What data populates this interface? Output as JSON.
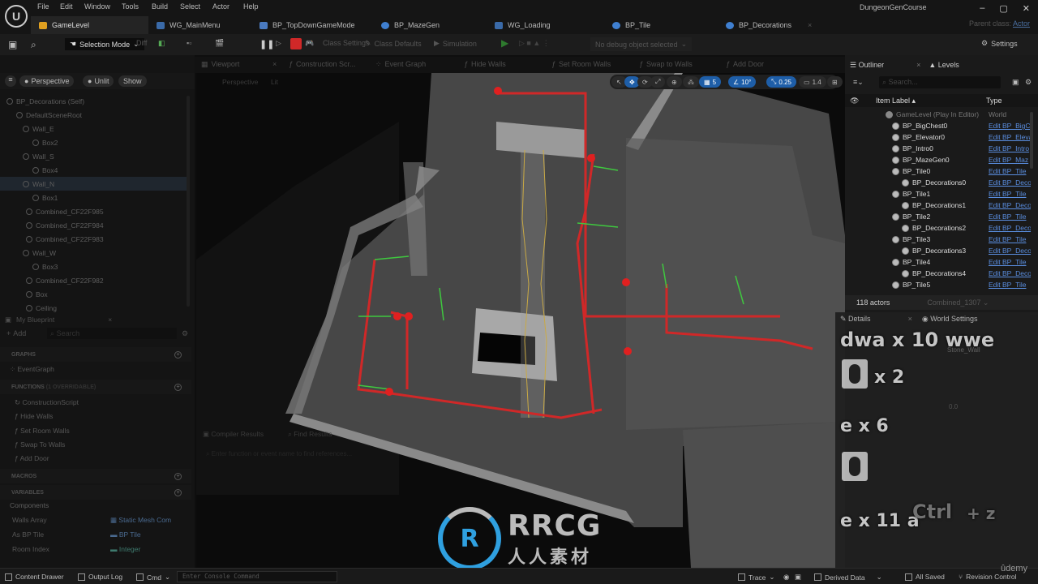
{
  "menu": [
    "File",
    "Edit",
    "Window",
    "Tools",
    "Build",
    "Select",
    "Actor",
    "Help"
  ],
  "project_name": "DungeonGenCourse",
  "parent_class": {
    "label": "Parent class:",
    "value": "Actor"
  },
  "doc_tabs": [
    {
      "label": "GameLevel",
      "icon": "level-icon",
      "active": true
    },
    {
      "label": "WG_MainMenu",
      "icon": "widget-icon"
    },
    {
      "label": "BP_TopDownGameMode",
      "icon": "gamemode-icon"
    },
    {
      "label": "BP_MazeGen",
      "icon": "blueprint-icon"
    },
    {
      "label": "WG_Loading",
      "icon": "widget-icon"
    },
    {
      "label": "BP_Tile",
      "icon": "blueprint-icon"
    },
    {
      "label": "BP_Decorations",
      "icon": "blueprint-icon"
    }
  ],
  "toolbar": {
    "selection_mode": "Selection Mode",
    "diff": "Diff",
    "class_settings": "Class Settings",
    "class_defaults": "Class Defaults",
    "simulation": "Simulation",
    "debug_object": "No debug object selected",
    "settings": "Settings"
  },
  "editor_tabs": [
    {
      "label": "Viewport 1"
    },
    {
      "label": "Viewport"
    },
    {
      "label": "Construction Scr..."
    },
    {
      "label": "Event Graph"
    },
    {
      "label": "Hide Walls"
    },
    {
      "label": "Set Room Walls"
    },
    {
      "label": "Swap to Walls"
    },
    {
      "label": "Add Door"
    }
  ],
  "viewport_toolbar": {
    "perspective": "Perspective",
    "unlit": "Unlit",
    "show": "Show",
    "bp_perspective": "Perspective",
    "bp_lit": "Lit",
    "grid_snap": "5",
    "rotation_snap": "10°",
    "scale_snap": "0.25",
    "camera_speed": "1.4"
  },
  "components": {
    "root": "BP_Decorations (Self)",
    "items": [
      {
        "label": "DefaultSceneRoot",
        "depth": 1
      },
      {
        "label": "Wall_E",
        "depth": 2
      },
      {
        "label": "Box2",
        "depth": 3
      },
      {
        "label": "Wall_S",
        "depth": 2
      },
      {
        "label": "Box4",
        "depth": 3
      },
      {
        "label": "Wall_N",
        "depth": 2,
        "selected": true
      },
      {
        "label": "Box1",
        "depth": 3
      },
      {
        "label": "Combined_CF22F985",
        "depth": 2
      },
      {
        "label": "Combined_CF22F984",
        "depth": 2
      },
      {
        "label": "Combined_CF22F983",
        "depth": 2
      },
      {
        "label": "Wall_W",
        "depth": 2
      },
      {
        "label": "Box3",
        "depth": 3
      },
      {
        "label": "Combined_CF22F982",
        "depth": 2
      },
      {
        "label": "Box",
        "depth": 2
      },
      {
        "label": "Ceiling",
        "depth": 2
      }
    ]
  },
  "my_blueprint": {
    "title": "My Blueprint",
    "add": "Add",
    "search_placeholder": "Search",
    "graphs_label": "GRAPHS",
    "event_graph": "EventGraph",
    "functions_label": "FUNCTIONS",
    "functions_overridable": "(1 OVERRIDABLE)",
    "functions": [
      "ConstructionScript",
      "Hide Walls",
      "Set Room Walls",
      "Swap To Walls",
      "Add Door"
    ],
    "macros_label": "MACROS",
    "variables_label": "VARIABLES",
    "components_label": "Components",
    "variables": [
      {
        "name": "Walls Array",
        "type": "Static Mesh Com"
      },
      {
        "name": "As BP Tile",
        "type": "BP Tile"
      },
      {
        "name": "Room Index",
        "type": "Integer"
      }
    ]
  },
  "bottom_tabs": {
    "compiler": "Compiler Results",
    "find": "Find Results",
    "find_placeholder": "Enter function or event name to find references..."
  },
  "outliner": {
    "title": "Outliner",
    "levels": "Levels",
    "search_placeholder": "Search...",
    "col_label": "Item Label",
    "col_type": "Type",
    "rows": [
      {
        "label": "GameLevel (Play In Editor)",
        "type": "World",
        "depth": 0
      },
      {
        "label": "BP_BigChest0",
        "type": "Edit BP_BigC",
        "depth": 1
      },
      {
        "label": "BP_Elevator0",
        "type": "Edit BP_Eleva",
        "depth": 1
      },
      {
        "label": "BP_Intro0",
        "type": "Edit BP_Intro",
        "depth": 1
      },
      {
        "label": "BP_MazeGen0",
        "type": "Edit BP_Maz",
        "depth": 1
      },
      {
        "label": "BP_Tile0",
        "type": "Edit BP_Tile",
        "depth": 1
      },
      {
        "label": "BP_Decorations0",
        "type": "Edit BP_Deco",
        "depth": 2
      },
      {
        "label": "BP_Tile1",
        "type": "Edit BP_Tile",
        "depth": 1
      },
      {
        "label": "BP_Decorations1",
        "type": "Edit BP_Deco",
        "depth": 2
      },
      {
        "label": "BP_Tile2",
        "type": "Edit BP_Tile",
        "depth": 1
      },
      {
        "label": "BP_Decorations2",
        "type": "Edit BP_Deco",
        "depth": 2
      },
      {
        "label": "BP_Tile3",
        "type": "Edit BP_Tile",
        "depth": 1
      },
      {
        "label": "BP_Decorations3",
        "type": "Edit BP_Deco",
        "depth": 2
      },
      {
        "label": "BP_Tile4",
        "type": "Edit BP_Tile",
        "depth": 1
      },
      {
        "label": "BP_Decorations4",
        "type": "Edit BP_Deco",
        "depth": 2
      },
      {
        "label": "BP_Tile5",
        "type": "Edit BP_Tile",
        "depth": 1
      }
    ],
    "actor_count": "118 actors",
    "combined_dropdown": "Combined_1307"
  },
  "details": {
    "tab": "Details",
    "world_settings": "World Settings",
    "tick_interval": "0.0",
    "material": "Stone_Wall"
  },
  "key_overlay": [
    "dwa x 10 wwe",
    "x 2",
    "e x 6",
    "e x 11 a",
    "Ctrl",
    "+ z"
  ],
  "statusbar": {
    "content_drawer": "Content Drawer",
    "output_log": "Output Log",
    "cmd": "Cmd",
    "console_placeholder": "Enter Console Command",
    "trace": "Trace",
    "derived_data": "Derived Data",
    "all_saved": "All Saved",
    "revision_control": "Revision Control"
  },
  "watermark": {
    "brand": "RRCG",
    "sub": "人人素材",
    "udemy": "ûdemy"
  }
}
